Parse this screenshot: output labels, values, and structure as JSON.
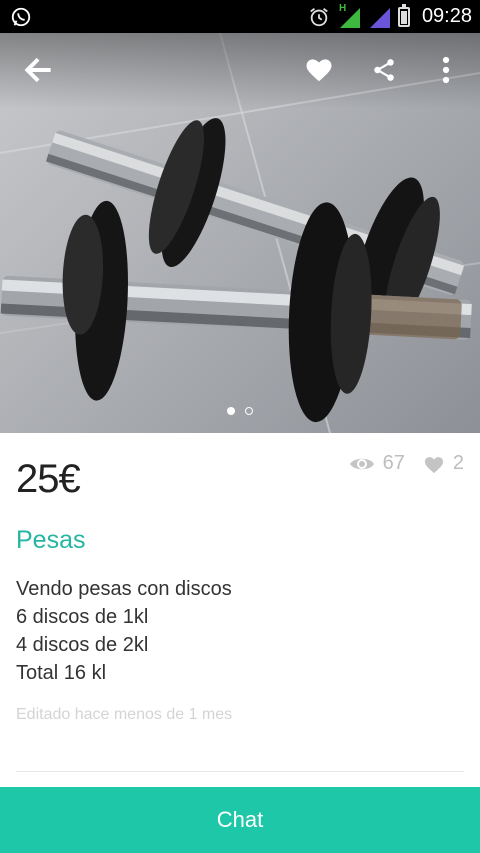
{
  "status_bar": {
    "time": "09:28",
    "network_label": "H",
    "icons": [
      "whatsapp-icon",
      "alarm-icon",
      "signal-icon",
      "signal-icon",
      "battery-icon"
    ]
  },
  "header": {
    "icons": [
      "back-arrow-icon",
      "heart-icon",
      "share-icon",
      "more-vert-icon"
    ]
  },
  "gallery": {
    "image": "dumbbells-photo",
    "page_count": 2,
    "active_page": 1
  },
  "item": {
    "price": "25€",
    "views": "67",
    "favorites": "2",
    "title": "Pesas",
    "description": [
      "Vendo pesas con discos",
      "6 discos de 1kl",
      "4 discos de 2kl",
      "Total 16 kl"
    ],
    "edited": "Editado hace menos de 1 mes"
  },
  "actions": {
    "chat_label": "Chat"
  },
  "colors": {
    "accent": "#1ec7a8",
    "title": "#26b5a3",
    "statusbar": "#000000"
  }
}
